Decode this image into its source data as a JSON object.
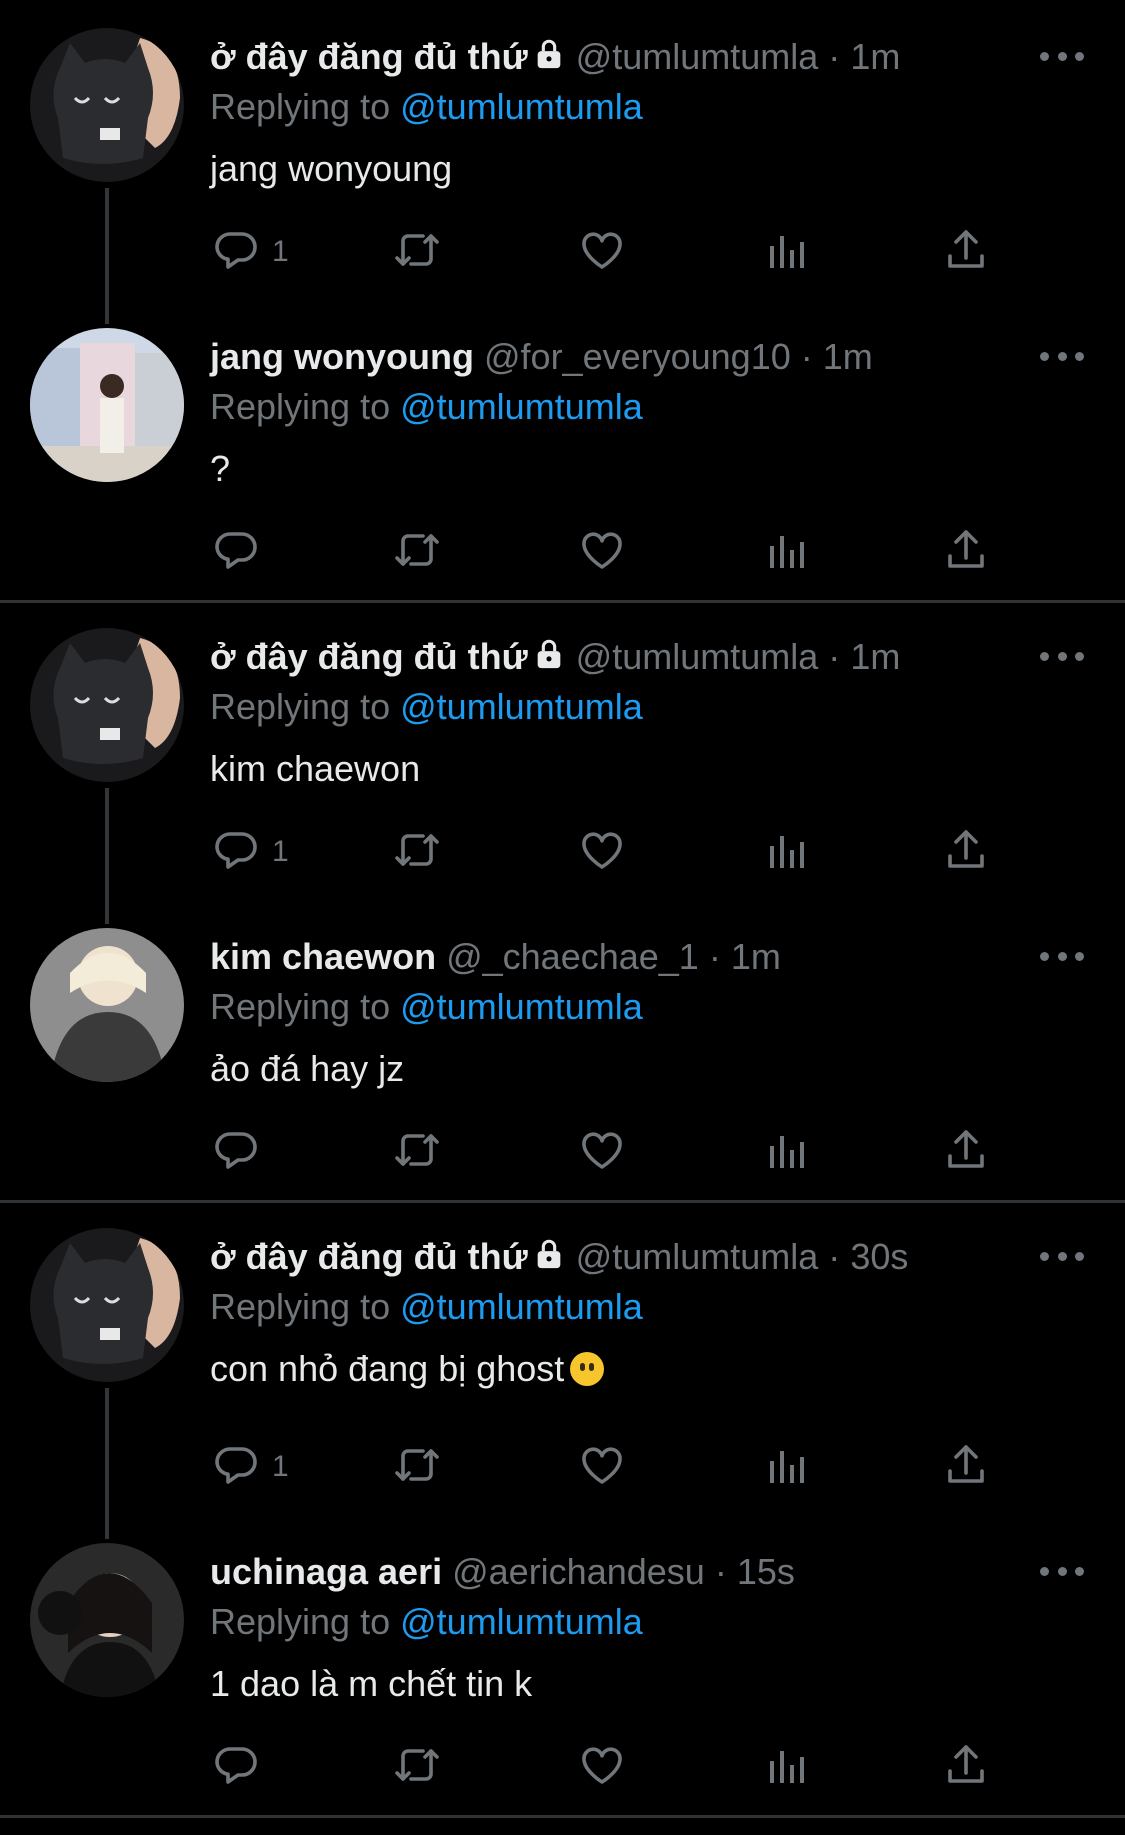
{
  "colors": {
    "background": "#000000",
    "name": "#e7e9ea",
    "muted": "#71767b",
    "mention": "#1d9bf0",
    "separator": "#2f3336"
  },
  "tweets": [
    {
      "name": "ở đây đăng đủ thứ",
      "handle": "@tumlumtumla",
      "time": "1m",
      "replying_prefix": "Replying to",
      "replying_to": "@tumlumtumla",
      "text": "jang wonyoung",
      "reply_count": "1",
      "avatar": "black-cat-plush-avatar",
      "locked": true
    },
    {
      "name": "jang wonyoung",
      "handle": "@for_everyoung10",
      "time": "1m",
      "replying_prefix": "Replying to",
      "replying_to": "@tumlumtumla",
      "text": "?",
      "reply_count": "",
      "avatar": "street-photo-avatar",
      "locked": false
    },
    {
      "name": "ở đây đăng đủ thứ",
      "handle": "@tumlumtumla",
      "time": "1m",
      "replying_prefix": "Replying to",
      "replying_to": "@tumlumtumla",
      "text": "kim chaewon",
      "reply_count": "1",
      "avatar": "black-cat-plush-avatar",
      "locked": true
    },
    {
      "name": "kim chaewon",
      "handle": "@_chaechae_1",
      "time": "1m",
      "replying_prefix": "Replying to",
      "replying_to": "@tumlumtumla",
      "text": "ảo đá hay jz",
      "reply_count": "",
      "avatar": "person-photo-avatar",
      "locked": false
    },
    {
      "name": "ở đây đăng đủ thứ",
      "handle": "@tumlumtumla",
      "time": "30s",
      "replying_prefix": "Replying to",
      "replying_to": "@tumlumtumla",
      "text": "con nhỏ đang bị ghost",
      "reply_count": "1",
      "avatar": "black-cat-plush-avatar",
      "locked": true,
      "emoji": "no-mouth-emoji"
    },
    {
      "name": "uchinaga aeri",
      "handle": "@aerichandesu",
      "time": "15s",
      "replying_prefix": "Replying to",
      "replying_to": "@tumlumtumla",
      "text": "1 dao là m chết tin k",
      "reply_count": "",
      "avatar": "headphones-photo-avatar",
      "locked": false
    }
  ],
  "dot_separator": "·",
  "icons": [
    "reply-icon",
    "retweet-icon",
    "like-icon",
    "views-icon",
    "share-icon",
    "more-icon",
    "lock-icon"
  ]
}
